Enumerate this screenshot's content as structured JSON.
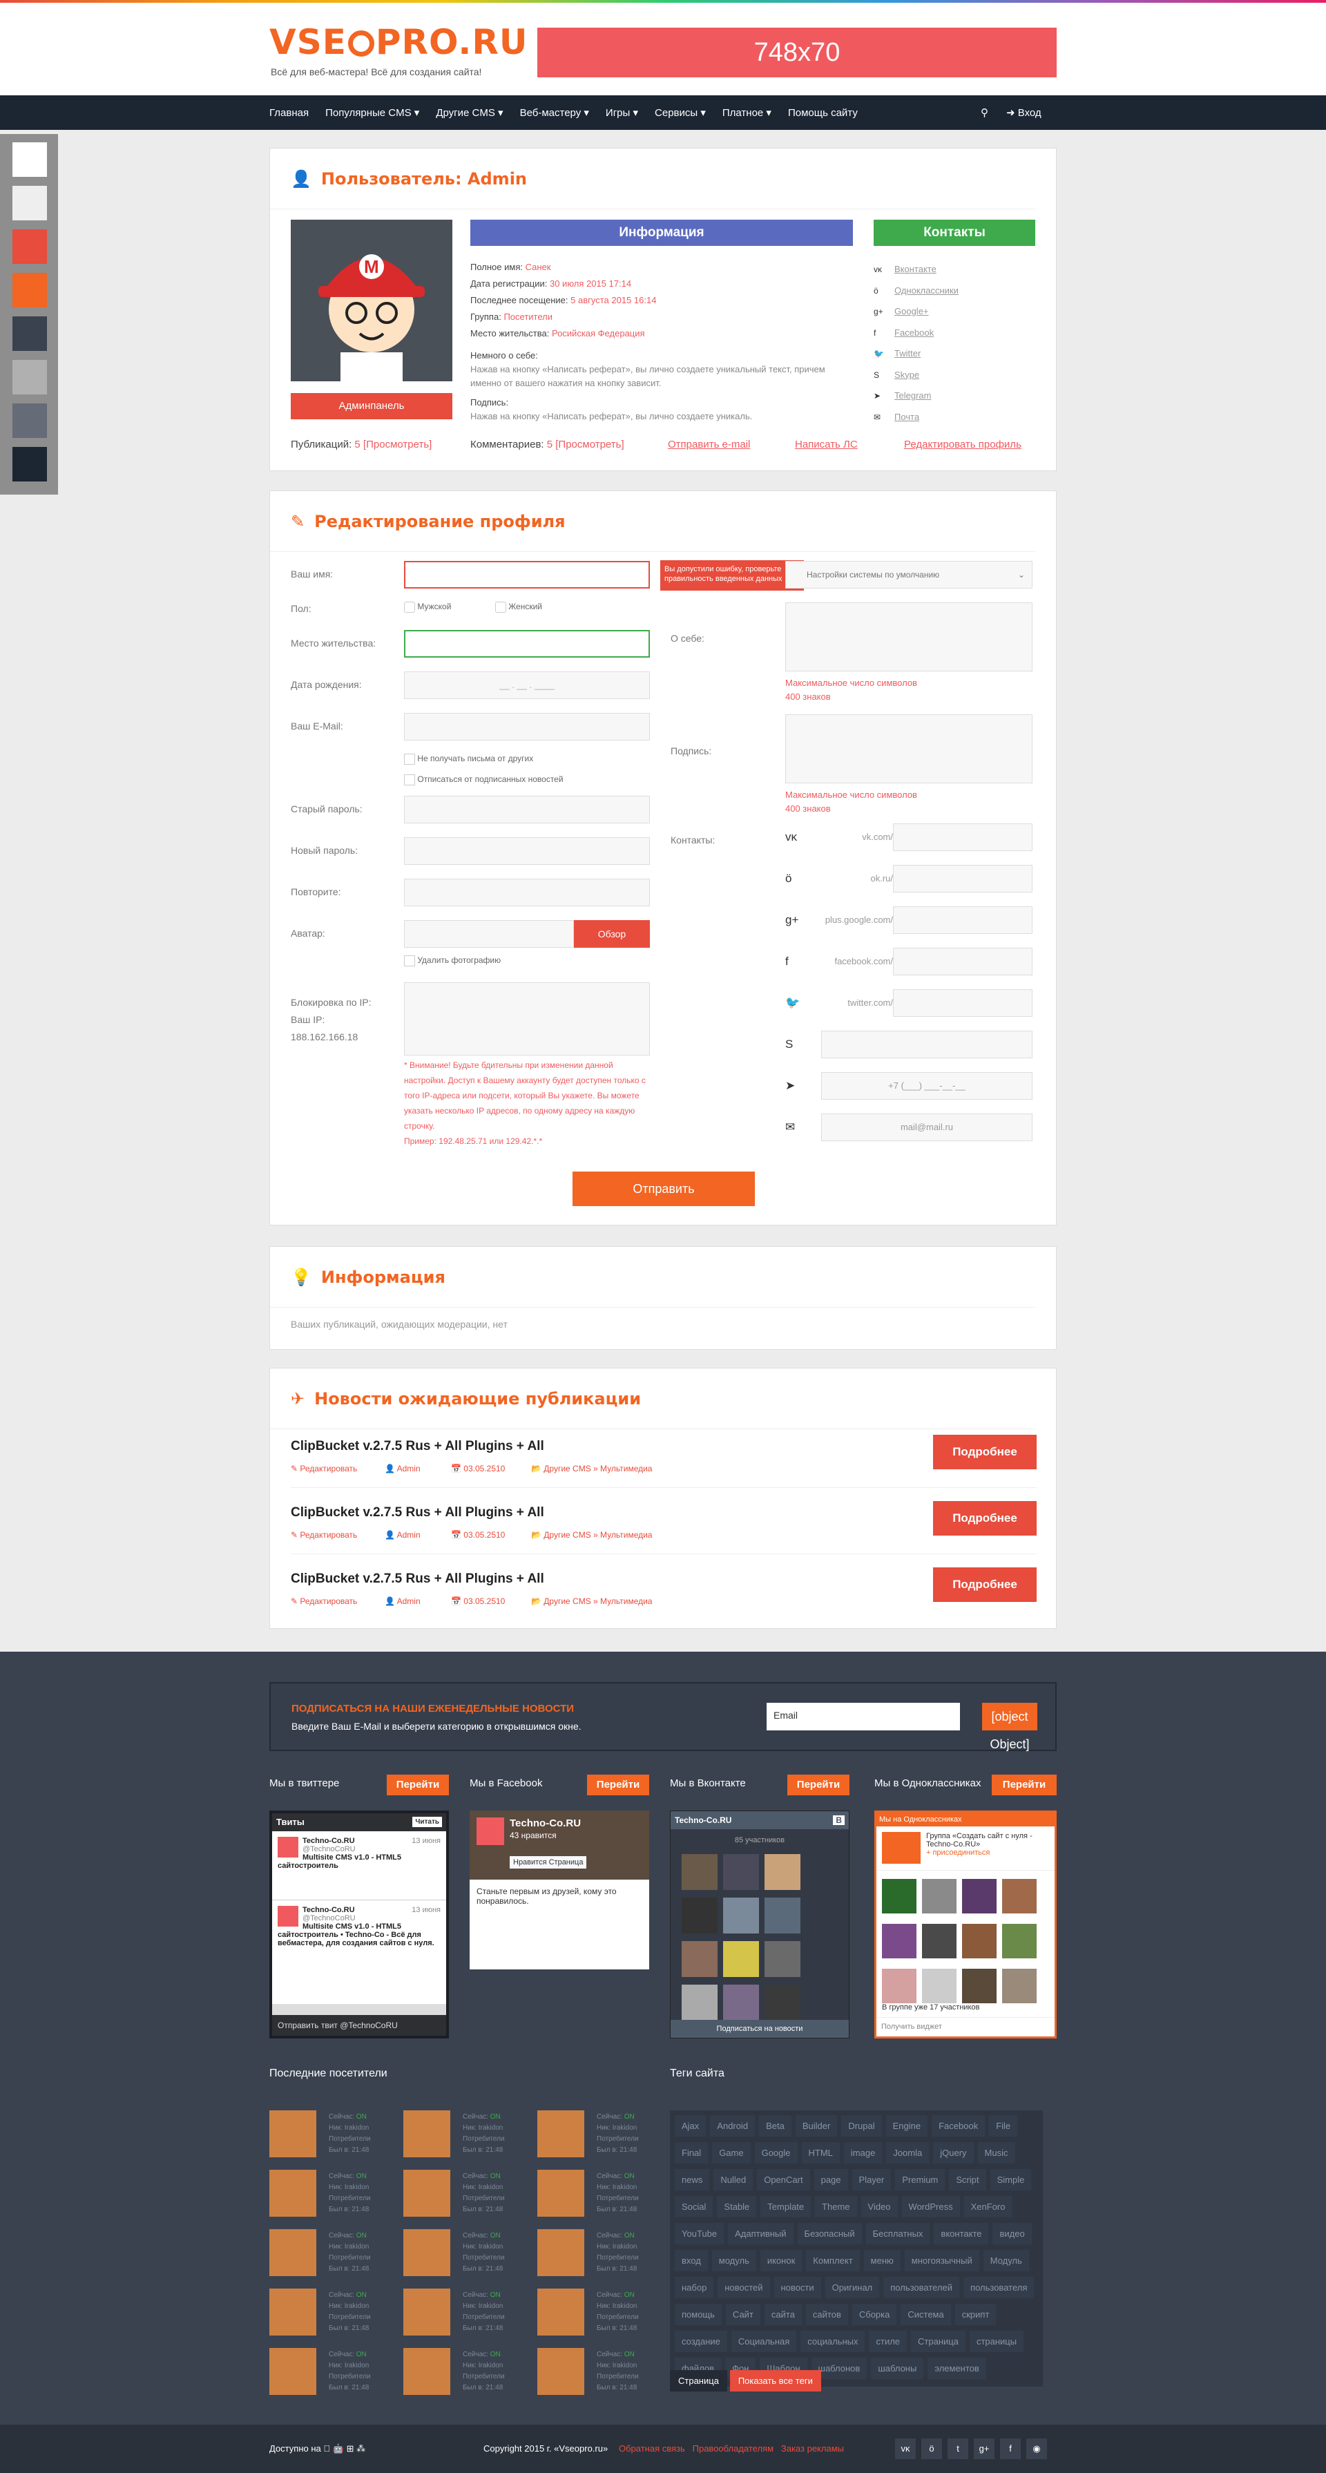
{
  "site": {
    "logo": "VSEOPRO.RU",
    "logo_left": "VSE",
    "logo_right": "PRO.RU",
    "slogan": "Всё для веб-мастера! Всё для создания сайта!",
    "banner": "748x70"
  },
  "nav": {
    "items": [
      "Главная",
      "Популярные CMS",
      "Другие CMS",
      "Веб-мастеру",
      "Игры",
      "Сервисы",
      "Платное",
      "Помощь сайту"
    ],
    "login": "Вход"
  },
  "swatches": [
    "#ffffff",
    "#eeeeee",
    "#e74c3c",
    "#f26522",
    "#3a4250",
    "#b0b0b0",
    "#666b78",
    "#1c2532"
  ],
  "profile": {
    "title": "Пользователь: Admin",
    "admin_btn": "Админпанель",
    "info_header": "Информация",
    "contacts_header": "Контакты",
    "fields": [
      {
        "k": "Полное имя:",
        "v": "Санек"
      },
      {
        "k": "Дата регистрации:",
        "v": "30 июля 2015 17:14"
      },
      {
        "k": "Последнее посещение:",
        "v": "5 августа 2015 16:14"
      },
      {
        "k": "Группа:",
        "v": "Посетители"
      },
      {
        "k": "Место жительства:",
        "v": "Росийская Федерация"
      }
    ],
    "about_k": "Немного о себе:",
    "about_v": "Нажав на кнопку «Написать реферат», вы лично создаете уникальный текст, причем именно от вашего нажатия на кнопку зависит.",
    "sig_k": "Подпись:",
    "sig_v": "Нажав на кнопку «Написать реферат», вы лично создаете уникаль.",
    "contacts": [
      "Вконтакте",
      "Одноклассники",
      "Google+",
      "Facebook",
      "Twitter",
      "Skype",
      "Telegram",
      "Почта"
    ],
    "pubs_k": "Публикаций:",
    "pubs_v": "5 [Просмотреть]",
    "comm_k": "Комментариев:",
    "comm_v": "5 [Просмотреть]",
    "send_email": "Отправить e-mail",
    "write_pm": "Написать  ЛС",
    "edit_profile": "Редактировать профиль"
  },
  "edit": {
    "title": "Редактирование профиля",
    "name": "Ваш имя:",
    "error_tip": "Вы допустили ошибку, проверьте правильность введенных данных",
    "timezone": "Настройки системы по умолчанию",
    "gender": "Пол:",
    "male": "Мужской",
    "female": "Женский",
    "location": "Место жительства:",
    "about": "О себе:",
    "max": "Максимальное число символов",
    "max_n": "400 знаков",
    "birth": "Дата рождения:",
    "birth_ph": "__   .   __   .   ____",
    "email": "Ваш E-Mail:",
    "no_mail": "Не получать письма от других",
    "unsub": "Отписаться от подписанных новостей",
    "signature": "Подпись:",
    "old_pw": "Старый пароль:",
    "new_pw": "Новый пароль:",
    "repeat": "Повторите:",
    "avatar": "Аватар:",
    "browse": "Обзор",
    "del_photo": "Удалить фотографию",
    "contacts": "Контакты:",
    "ip_block": "Блокировка по IP:",
    "your_ip": "Ваш IP: 188.162.166.18",
    "warning": "* Внимание! Будьте бдительны при изменении данной настройки. Доступ к Вашему аккаунту будет доступен только с того IP-адреса или подсети, который Вы укажете. Вы можете указать несколько IP адресов, по одному адресу на каждую строчку.",
    "example": "Пример: 192.48.25.71 или 129.42.*.*",
    "submit": "Отправить",
    "social": [
      {
        "icon": "vk-icon",
        "ph": "vk.com/"
      },
      {
        "icon": "ok-icon",
        "ph": "ok.ru/"
      },
      {
        "icon": "googleplus-icon",
        "ph": "plus.google.com/"
      },
      {
        "icon": "facebook-icon",
        "ph": "facebook.com/"
      },
      {
        "icon": "twitter-icon",
        "ph": "twitter.com/"
      },
      {
        "icon": "skype-icon",
        "ph": ""
      },
      {
        "icon": "telegram-icon",
        "ph": "+7 (___) ___-__-__"
      },
      {
        "icon": "mail-icon",
        "ph": "mail@mail.ru"
      }
    ]
  },
  "info": {
    "title": "Информация",
    "text": "Ваших публикаций, ожидающих модерации, нет"
  },
  "news": {
    "title": "Новости ожидающие публикации",
    "items": [
      {
        "t": "ClipBucket v.2.7.5 Rus + All Plugins + All",
        "edit": "Редактировать",
        "author": "Admin",
        "date": "03.05.2510",
        "cat": "Другие CMS » Мультимедиа",
        "more": "Подробнее"
      },
      {
        "t": "ClipBucket v.2.7.5 Rus + All Plugins + All",
        "edit": "Редактировать",
        "author": "Admin",
        "date": "03.05.2510",
        "cat": "Другие CMS » Мультимедиа",
        "more": "Подробнее"
      },
      {
        "t": "ClipBucket v.2.7.5 Rus + All Plugins + All",
        "edit": "Редактировать",
        "author": "Admin",
        "date": "03.05.2510",
        "cat": "Другие CMS » Мультимедиа",
        "more": "Подробнее"
      }
    ]
  },
  "footer": {
    "sub_title": "ПОДПИСАТЬСЯ НА НАШИ ЕЖЕНЕДЕЛЬНЫЕ НОВОСТИ",
    "sub_text": "Введите Ваш E-Mail и выберети категорию в открывшимся окне.",
    "email_ph": "Email",
    "ok": {
      "head": "Мы на Одноклассниках",
      "group": "Группа «Создать сайт с нуля - Techno-Co.RU»",
      "join": "+ присоединиться",
      "count": "В группе уже 17 участников",
      "widget": "Получить виджет"
    },
    "widgets": [
      {
        "title": "Мы в твиттере",
        "go": "Перейти"
      },
      {
        "title": "Мы в Facebook",
        "go": "Перейти"
      },
      {
        "title": "Мы в Вконтакте",
        "go": "Перейти"
      },
      {
        "title": "Мы в Одноклассниках",
        "go": "Перейти"
      }
    ],
    "tw": {
      "title": "Твиты",
      "follow": "Читать",
      "name": "Techno-Co.RU",
      "handle": "@TechnoCoRU",
      "d1": "13 июня",
      "t1": "Multisite CMS v1.0 - HTML5 сайтостроитель",
      "d2": "13 июня",
      "t2": "Multisite CMS v1.0 - HTML5 сайтостроитель • Techno-Co - Всё для вебмастера, для создания сайтов с нуля.",
      "send": "Отправить твит @TechnoCoRU"
    },
    "fb": {
      "name": "Techno-Co.RU",
      "likes": "43 нравится",
      "like": "Нравится Страница",
      "text": "Станьте первым из друзей, кому это понравилось."
    },
    "vk": {
      "name": "Techno-Co.RU",
      "members": "85 участников",
      "sub": "Подписаться на новости"
    },
    "visitors_title": "Последние посетители",
    "tags_title": "Теги сайта",
    "visitor": {
      "l1": "Сейчас: ",
      "on": "ON",
      "l2": "Ник: Irakidon",
      "l3": "Потребители",
      "l4": "Был в: 21:48"
    },
    "tags": [
      "Ajax",
      "Android",
      "Beta",
      "Builder",
      "Drupal",
      "Engine",
      "Facebook",
      "File",
      "Final",
      "Game",
      "Google",
      "HTML",
      "image",
      "Joomla",
      "jQuery",
      "Music",
      "news",
      "Nulled",
      "OpenCart",
      "page",
      "Player",
      "Premium",
      "Script",
      "Simple",
      "Social",
      "Stable",
      "Template",
      "Theme",
      "Video",
      "WordPress",
      "XenForo",
      "YouTube",
      "Адаптивный",
      "Безопасный",
      "Бесплатных",
      "вконтакте",
      "видео",
      "вход",
      "модуль",
      "иконок",
      "Комплект",
      "меню",
      "многоязычный",
      "Модуль",
      "набор",
      "новостей",
      "новости",
      "Оригинал",
      "пользователей",
      "пользователя",
      "помощь",
      "Сайт",
      "сайта",
      "сайтов",
      "Сборка",
      "Система",
      "скрипт",
      "создание",
      "Социальная",
      "социальных",
      "стиле",
      "Страница",
      "страницы",
      "файлов",
      "Фон",
      "Шаблон",
      "шаблонов",
      "шаблоны",
      "элементов"
    ],
    "show_all_tags": "Показать все теги",
    "active_tag": "Страница",
    "copy": "Copyright 2015 г. «Vseopro.ru»",
    "links": [
      "Обратная связь",
      "Правообладателям",
      "Заказ рекламы"
    ],
    "available": "Доступно на"
  }
}
